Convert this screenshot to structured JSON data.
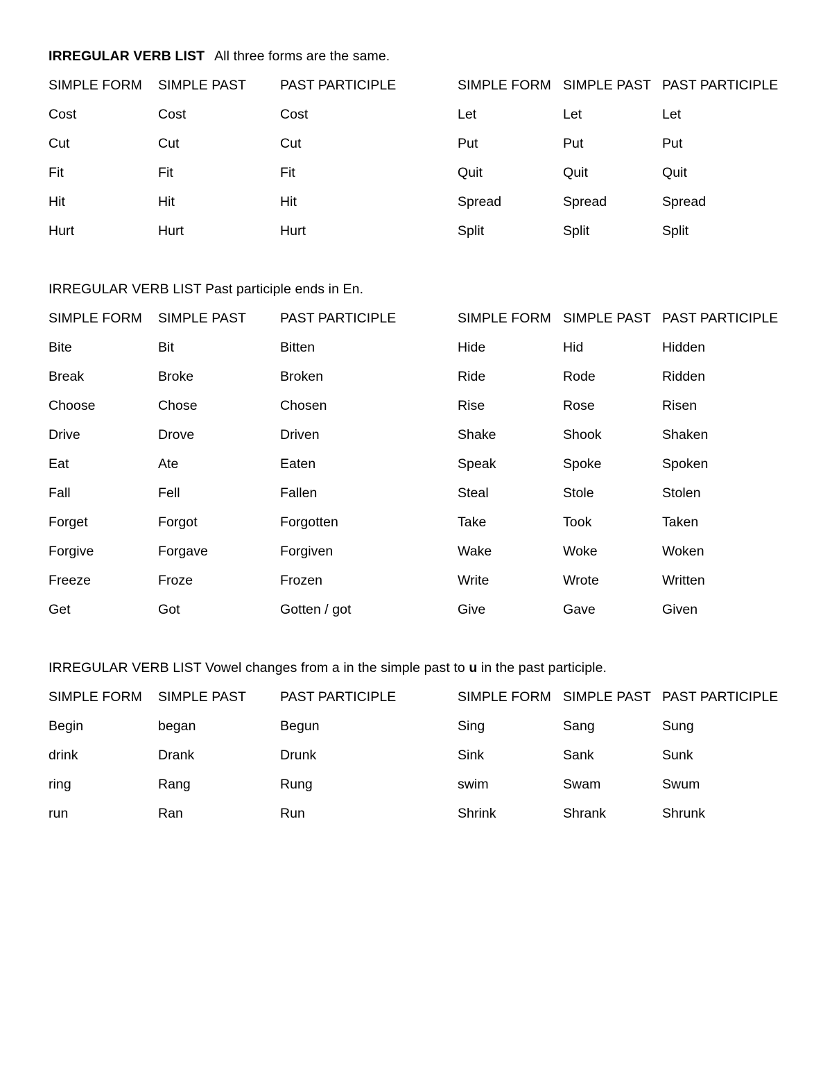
{
  "document": {
    "title": "IRREGULAR VERB LIST",
    "column_headers": [
      "SIMPLE FORM",
      "SIMPLE PAST",
      "PAST PARTICIPLE"
    ]
  },
  "sections": [
    {
      "heading_bold": "IRREGULAR VERB LIST",
      "heading_rest": "All three forms are the same.",
      "headers_left": [
        "SIMPLE FORM",
        "SIMPLE PAST",
        "PAST PARTICIPLE"
      ],
      "headers_right": [
        "SIMPLE FORM",
        "SIMPLE PAST",
        "PAST PARTICIPLE"
      ],
      "rows": [
        [
          "Cost",
          "Cost",
          "Cost",
          "Let",
          "Let",
          "Let"
        ],
        [
          "Cut",
          "Cut",
          "Cut",
          "Put",
          "Put",
          "Put"
        ],
        [
          "Fit",
          "Fit",
          "Fit",
          "Quit",
          "Quit",
          "Quit"
        ],
        [
          "Hit",
          "Hit",
          "Hit",
          "Spread",
          "Spread",
          "Spread"
        ],
        [
          "Hurt",
          "Hurt",
          "Hurt",
          "Split",
          "Split",
          "Split"
        ]
      ]
    },
    {
      "heading_bold": "",
      "heading_rest": "IRREGULAR VERB LIST Past participle ends in En.",
      "headers_left": [
        "SIMPLE FORM",
        "SIMPLE PAST",
        "PAST PARTICIPLE"
      ],
      "headers_right": [
        "SIMPLE FORM",
        "SIMPLE PAST",
        "PAST PARTICIPLE"
      ],
      "rows": [
        [
          "Bite",
          "Bit",
          "Bitten",
          "Hide",
          "Hid",
          "Hidden"
        ],
        [
          "Break",
          "Broke",
          "Broken",
          "Ride",
          "Rode",
          "Ridden"
        ],
        [
          "Choose",
          "Chose",
          "Chosen",
          "Rise",
          "Rose",
          "Risen"
        ],
        [
          "Drive",
          "Drove",
          "Driven",
          "Shake",
          "Shook",
          "Shaken"
        ],
        [
          "Eat",
          "Ate",
          "Eaten",
          "Speak",
          "Spoke",
          "Spoken"
        ],
        [
          "Fall",
          "Fell",
          "Fallen",
          "Steal",
          "Stole",
          "Stolen"
        ],
        [
          "Forget",
          "Forgot",
          "Forgotten",
          "Take",
          "Took",
          "Taken"
        ],
        [
          "Forgive",
          "Forgave",
          "Forgiven",
          "Wake",
          "Woke",
          "Woken"
        ],
        [
          "Freeze",
          "Froze",
          "Frozen",
          "Write",
          "Wrote",
          "Written"
        ],
        [
          "Get",
          "Got",
          "Gotten / got",
          "Give",
          "Gave",
          "Given"
        ]
      ]
    },
    {
      "heading_bold": "",
      "heading_part1": "IRREGULAR VERB LIST Vowel changes from a in the simple past to ",
      "heading_emphasis": "u",
      "heading_part2": " in the past participle.",
      "heading_rest": "IRREGULAR VERB LIST Vowel changes from a in the simple past to u in the past participle.",
      "headers_left": [
        "SIMPLE FORM",
        "SIMPLE PAST",
        "PAST PARTICIPLE"
      ],
      "headers_right": [
        "SIMPLE FORM",
        "SIMPLE PAST",
        "PAST PARTICIPLE"
      ],
      "rows": [
        [
          "Begin",
          "began",
          "Begun",
          "Sing",
          "Sang",
          "Sung"
        ],
        [
          "drink",
          "Drank",
          "Drunk",
          "Sink",
          "Sank",
          "Sunk"
        ],
        [
          "ring",
          "Rang",
          "Rung",
          "swim",
          "Swam",
          "Swum"
        ],
        [
          "run",
          "Ran",
          "Run",
          "Shrink",
          "Shrank",
          "Shrunk"
        ]
      ]
    }
  ]
}
